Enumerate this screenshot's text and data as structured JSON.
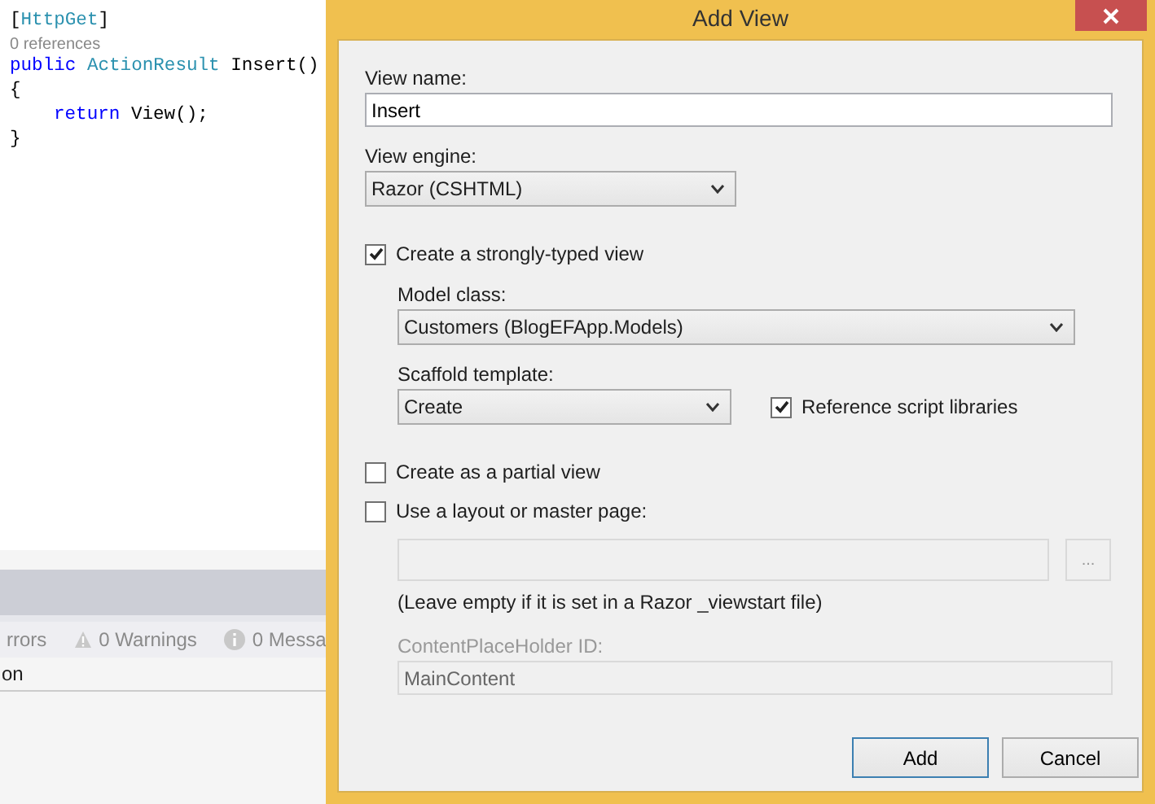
{
  "editor": {
    "code_lines": [
      {
        "tokens": [
          {
            "text": "[",
            "kind": "plain"
          },
          {
            "text": "HttpGet",
            "kind": "type"
          },
          {
            "text": "]",
            "kind": "plain"
          }
        ]
      },
      {
        "tokens": [
          {
            "text": "0 references",
            "kind": "lens"
          }
        ]
      },
      {
        "tokens": [
          {
            "text": "public ",
            "kind": "keyword"
          },
          {
            "text": "ActionResult",
            "kind": "type"
          },
          {
            "text": " Insert()",
            "kind": "plain"
          }
        ]
      },
      {
        "tokens": [
          {
            "text": "{",
            "kind": "plain"
          }
        ],
        "children": [
          {
            "tokens": [
              {
                "text": "return",
                "kind": "keyword"
              },
              {
                "text": " View();",
                "kind": "plain"
              }
            ]
          }
        ]
      },
      {
        "tokens": [
          {
            "text": "}",
            "kind": "plain"
          }
        ]
      }
    ]
  },
  "error_list": {
    "filters": [
      {
        "label": "rrors",
        "kind": "errors"
      },
      {
        "label": "0 Warnings",
        "kind": "warnings"
      },
      {
        "label": "0 Messa",
        "kind": "messages"
      }
    ],
    "column_header": "on"
  },
  "dialog": {
    "title": "Add View",
    "view_name": {
      "label": "View name:",
      "value": "Insert"
    },
    "view_engine": {
      "label": "View engine:",
      "value": "Razor (CSHTML)"
    },
    "strongly_typed": {
      "label": "Create a strongly-typed view",
      "checked": true
    },
    "model_class": {
      "label": "Model class:",
      "value": "Customers (BlogEFApp.Models)"
    },
    "scaffold_template": {
      "label": "Scaffold template:",
      "value": "Create"
    },
    "reference_scripts": {
      "label": "Reference script libraries",
      "checked": true
    },
    "partial_view": {
      "label": "Create as a partial view",
      "checked": false
    },
    "use_layout": {
      "label": "Use a layout or master page:",
      "checked": false
    },
    "layout_path": {
      "disabled": true,
      "browse": "..."
    },
    "layout_note": "(Leave empty if it is set in a Razor _viewstart file)",
    "placeholder_id": {
      "label": "ContentPlaceHolder ID:",
      "value": "MainContent",
      "disabled": true
    },
    "buttons": [
      {
        "label": "Add",
        "default": true
      },
      {
        "label": "Cancel",
        "default": false
      }
    ]
  }
}
